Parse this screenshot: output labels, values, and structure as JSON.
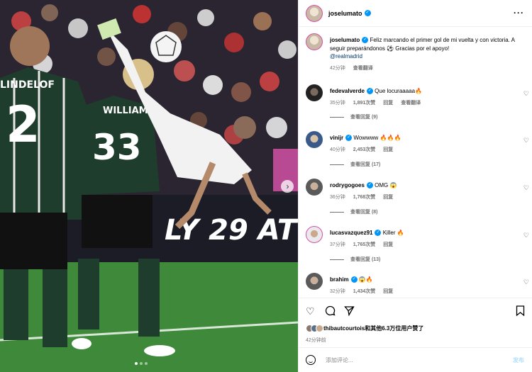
{
  "post": {
    "author": "joselumato",
    "caption_user": "joselumato",
    "caption_text": "Feliz marcando el primer gol de mi vuelta y con victoria. A seguir preparándonos ⚽ Gracias por el apoyo!",
    "caption_mention": "@realmadrid",
    "caption_time": "42分钟",
    "translate_label": "查看翻译",
    "liked_by": "thibautcourtois和其他6.3万位用户赞了",
    "post_time": "42分钟前",
    "comment_placeholder": "添加评论...",
    "post_button": "发布"
  },
  "photo": {
    "banner_text": "LY 29 AT",
    "jersey_left_name": "LINDELOF",
    "jersey_left_number": "2",
    "jersey_mid_name": "WILLIAMS",
    "jersey_mid_number": "33"
  },
  "comments": [
    {
      "user": "fedevalverde",
      "verified": true,
      "text": "Que locuraaaaa🔥",
      "time": "35分钟",
      "likes": "1,891次赞",
      "reply": "回复",
      "translate": "查看翻译",
      "replies": "查看回复 (9)"
    },
    {
      "user": "vinijr",
      "verified": true,
      "text": "Wowwww 🔥🔥🔥",
      "time": "40分钟",
      "likes": "2,453次赞",
      "reply": "回复",
      "replies": "查看回复 (17)"
    },
    {
      "user": "rodrygogoes",
      "verified": true,
      "text": "OMG 😱",
      "time": "36分钟",
      "likes": "1,768次赞",
      "reply": "回复",
      "replies": "查看回复 (8)"
    },
    {
      "user": "lucasvazquez91",
      "verified": true,
      "text": "Killer 🔥",
      "time": "37分钟",
      "likes": "1,765次赞",
      "reply": "回复",
      "replies": "查看回复 (13)"
    },
    {
      "user": "brahim",
      "verified": true,
      "text": "😱🔥",
      "time": "32分钟",
      "likes": "1,434次赞",
      "reply": "回复"
    }
  ],
  "icons": {
    "more": "more-options-icon",
    "like": "heart-icon",
    "comment": "comment-icon",
    "share": "share-icon",
    "save": "bookmark-icon",
    "emoji": "emoji-icon",
    "next": "chevron-right-icon"
  },
  "colors": {
    "verified": "#0095f6",
    "story_ring": "#d94fa0",
    "post_button": "#b2dffc",
    "pitch": "#3f8a3a"
  }
}
